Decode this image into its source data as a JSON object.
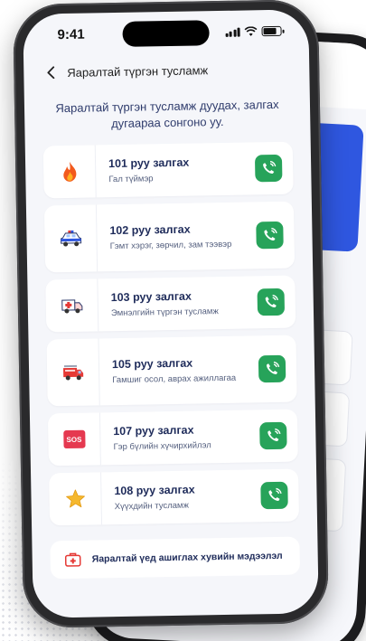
{
  "status_bar": {
    "time": "9:41"
  },
  "nav": {
    "title": "Яаралтай түргэн тусламж"
  },
  "intro": {
    "text": "Яаралтай түргэн тусламж дуудах, залгах дугаараа сонгоно уу."
  },
  "items": [
    {
      "title": "101 руу залгах",
      "subtitle": "Гал түймэр",
      "icon": "fire-icon"
    },
    {
      "title": "102 руу залгах",
      "subtitle": "Гэмт хэрэг, зөрчил, зам тээвэр",
      "icon": "police-car-icon"
    },
    {
      "title": "103 руу залгах",
      "subtitle": "Эмнэлгийн түргэн тусламж",
      "icon": "ambulance-icon"
    },
    {
      "title": "105 руу залгах",
      "subtitle": "Гамшиг осол, аврах ажиллагаа",
      "icon": "fire-truck-icon"
    },
    {
      "title": "107 руу залгах",
      "subtitle": "Гэр бүлийн хүчирхийлэл",
      "icon": "sos-icon",
      "badge": "SOS"
    },
    {
      "title": "108 руу залгах",
      "subtitle": "Хүүхдийн тусламж",
      "icon": "star-icon"
    }
  ],
  "info": {
    "label": "Яаралтай үед ашиглах хувийн мэдээлэл",
    "icon": "medical-kit-icon"
  },
  "colors": {
    "call_button": "#27a35a",
    "title_text": "#1e2b5a",
    "screen_bg": "#f5f6fa",
    "back_accent": "#2f57e0"
  }
}
